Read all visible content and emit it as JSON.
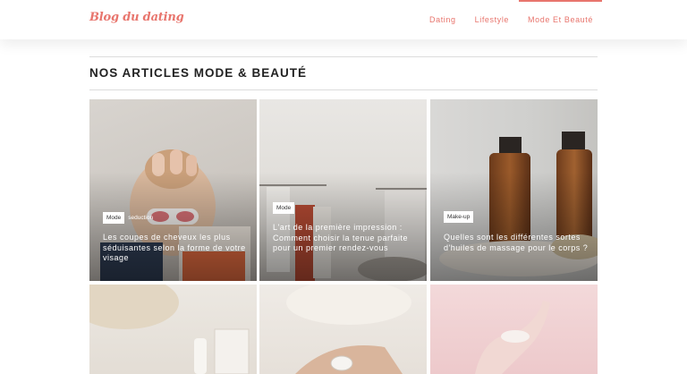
{
  "header": {
    "logo": "Blog du dating",
    "nav": [
      {
        "label": "Dating"
      },
      {
        "label": "Lifestyle"
      },
      {
        "label": "Mode Et Beauté"
      }
    ]
  },
  "section": {
    "title": "NOS ARTICLES MODE & BEAUTÉ"
  },
  "articles": [
    {
      "tags": [
        "Mode",
        "seduction"
      ],
      "title": "Les coupes de cheveux les plus séduisantes selon la forme de votre visage"
    },
    {
      "tags": [
        "Mode"
      ],
      "title": "L'art de la première impression : Comment choisir la tenue parfaite pour un premier rendez-vous"
    },
    {
      "tags": [
        "Make-up"
      ],
      "title": "Quelles sont les différentes sortes d'huiles de massage pour le corps ?"
    }
  ]
}
